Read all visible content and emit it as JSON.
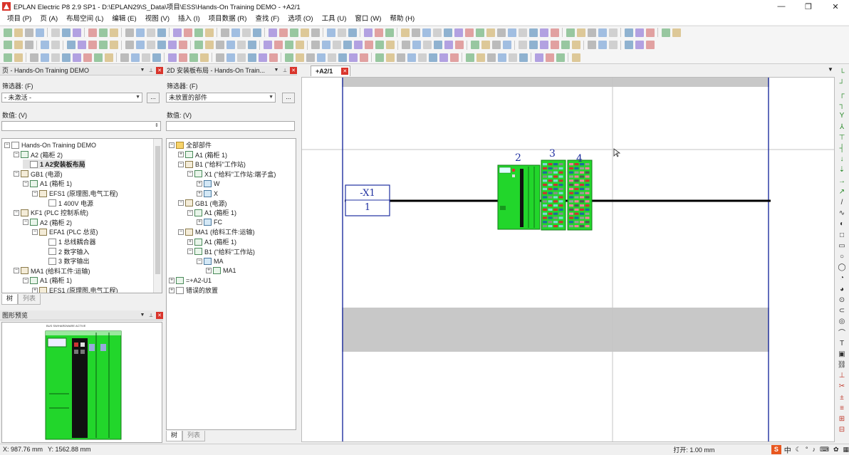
{
  "window": {
    "title": "EPLAN Electric P8 2.9 SP1 - D:\\EPLAN29\\S_Data\\项目\\ESS\\Hands-On Training DEMO - +A2/1",
    "minimize": "—",
    "maximize": "❐",
    "close": "✕"
  },
  "menu": [
    "项目 (P)",
    "页 (A)",
    "布局空间 (L)",
    "编辑 (E)",
    "视图 (V)",
    "插入 (I)",
    "项目数据 (R)",
    "查找 (F)",
    "选项 (O)",
    "工具 (U)",
    "窗口 (W)",
    "帮助 (H)"
  ],
  "page_nav": {
    "header": "页 - Hands-On Training DEMO",
    "filter_label": "筛选器: (F)",
    "filter_value": "- 未激活 -",
    "more": "...",
    "value_label": "数值: (V)",
    "value": "",
    "tree": [
      {
        "label": "Hands-On Training DEMO",
        "icon": "project-icon",
        "exp": "−"
      },
      {
        "label": "A2 (箱柜 2)",
        "icon": "cabinet-icon",
        "exp": "−"
      },
      {
        "label": "1 A2安装板布局",
        "icon": "page-icon",
        "exp": "",
        "selected": true
      },
      {
        "label": "GB1 (电源)",
        "icon": "group-icon",
        "exp": "−"
      },
      {
        "label": "A1 (箱柜 1)",
        "icon": "cabinet-icon",
        "exp": "−"
      },
      {
        "label": "EFS1 (原理图,电气工程)",
        "icon": "schematic-icon",
        "exp": "−"
      },
      {
        "label": "1 400V 电源",
        "icon": "page-icon",
        "exp": ""
      },
      {
        "label": "KF1 (PLC 控制系统)",
        "icon": "group-icon",
        "exp": "−"
      },
      {
        "label": "A2 (箱柜 2)",
        "icon": "cabinet-icon",
        "exp": "−"
      },
      {
        "label": "EFA1 (PLC 总览)",
        "icon": "schematic-icon",
        "exp": "−"
      },
      {
        "label": "1 总线耦合器",
        "icon": "page-icon",
        "exp": ""
      },
      {
        "label": "2 数字输入",
        "icon": "page-icon",
        "exp": ""
      },
      {
        "label": "3 数字输出",
        "icon": "page-icon",
        "exp": ""
      },
      {
        "label": "MA1 (给料工件:运输)",
        "icon": "group-icon",
        "exp": "−"
      },
      {
        "label": "A1 (箱柜 1)",
        "icon": "cabinet-icon",
        "exp": "−"
      },
      {
        "label": "EFS1 (原理图,电气工程)",
        "icon": "schematic-icon",
        "exp": "+"
      }
    ],
    "tabs": [
      "树",
      "列表"
    ]
  },
  "layout_nav": {
    "header": "2D 安装板布局 - Hands-On Train...",
    "filter_label": "筛选器: (F)",
    "filter_value": "未放置的部件",
    "more": "...",
    "value_label": "数值: (V)",
    "value": "",
    "tree": [
      {
        "label": "全部部件",
        "icon": "folder-icon",
        "exp": "−"
      },
      {
        "label": "A1 (箱柜 1)",
        "icon": "cabinet-icon",
        "exp": "+"
      },
      {
        "label": "B1 (\"给料\"工作站)",
        "icon": "group-icon",
        "exp": "−"
      },
      {
        "label": "X1 (\"给料\"工作站:端子盒)",
        "icon": "cabinet-icon",
        "exp": "−"
      },
      {
        "label": "W",
        "icon": "device-icon",
        "exp": "+"
      },
      {
        "label": "X",
        "icon": "device-icon",
        "exp": "+"
      },
      {
        "label": "GB1 (电源)",
        "icon": "group-icon",
        "exp": "−"
      },
      {
        "label": "A1 (箱柜 1)",
        "icon": "cabinet-icon",
        "exp": "−"
      },
      {
        "label": "FC",
        "icon": "device-icon",
        "exp": "+"
      },
      {
        "label": "MA1 (给料工件:运输)",
        "icon": "group-icon",
        "exp": "−"
      },
      {
        "label": "A1 (箱柜 1)",
        "icon": "cabinet-icon",
        "exp": "+"
      },
      {
        "label": "B1 (\"给料\"工作站)",
        "icon": "cabinet-icon",
        "exp": "−"
      },
      {
        "label": "MA",
        "icon": "device-icon",
        "exp": "−"
      },
      {
        "label": "MA1",
        "icon": "xy-icon",
        "exp": "+"
      },
      {
        "label": "=+A2-U1",
        "icon": "xy-icon",
        "exp": "+"
      },
      {
        "label": "错误的放置",
        "icon": "error-icon",
        "exp": "+"
      }
    ],
    "tabs": [
      "树",
      "列表"
    ]
  },
  "preview": {
    "header": "图形预览",
    "mini_text": "BUS SW/HARDWARE ACTIVE"
  },
  "document": {
    "tab": "+A2/1",
    "terminal_label": "-X1",
    "terminal_number": "1",
    "module_numbers": [
      "2",
      "3",
      "4"
    ]
  },
  "status": {
    "x": "X: 987.76 mm",
    "y": "Y: 1562.88 mm",
    "open": "打开: 1.00 mm",
    "ime": [
      "中",
      "°"
    ]
  },
  "colors": {
    "green": "#22d62b",
    "dark_green": "#157a1b",
    "rail_gray": "#c8c8c8",
    "accent_blue": "#1f2fa0",
    "close_red": "#d9342b"
  }
}
